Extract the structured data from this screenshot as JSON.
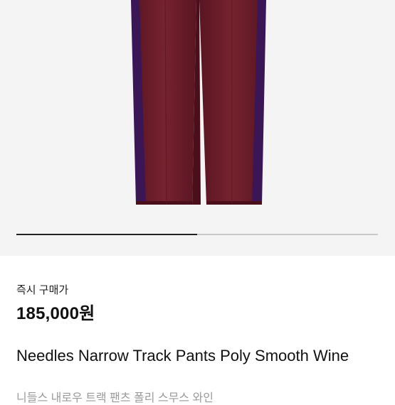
{
  "product": {
    "image_index_indicator": {
      "progress": 0.5
    },
    "price_label": "즉시 구매가",
    "price": "185,000원",
    "title": "Needles Narrow Track Pants Poly Smooth Wine",
    "subtitle_ko": "니들스 내로우 트랙 팬츠 폴리 스무스 와인"
  },
  "colors": {
    "background": "#f4f4f4",
    "pants_wine": "#6e1e2a",
    "stripe_purple": "#3a1656",
    "indicator_active": "#222222"
  }
}
